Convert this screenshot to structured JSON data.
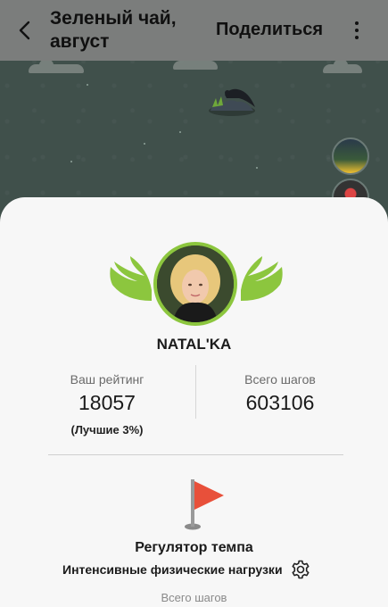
{
  "header": {
    "title": "Зеленый чай, август",
    "share_label": "Поделиться"
  },
  "profile": {
    "username": "NATAL'KA"
  },
  "stats": {
    "rating_label": "Ваш рейтинг",
    "rating_value": "18057",
    "rating_note": "(Лучшие 3%)",
    "steps_label": "Всего шагов",
    "steps_value": "603106"
  },
  "pace": {
    "title": "Регулятор темпа",
    "subtitle": "Интенсивные физические нагрузки"
  },
  "bottom": {
    "steps_label": "Всего шагов"
  },
  "colors": {
    "accent_green": "#8cc63e",
    "flag_red": "#e8503a",
    "header_bg": "#7b7d7c",
    "sheet_bg": "#f7f7f7"
  }
}
